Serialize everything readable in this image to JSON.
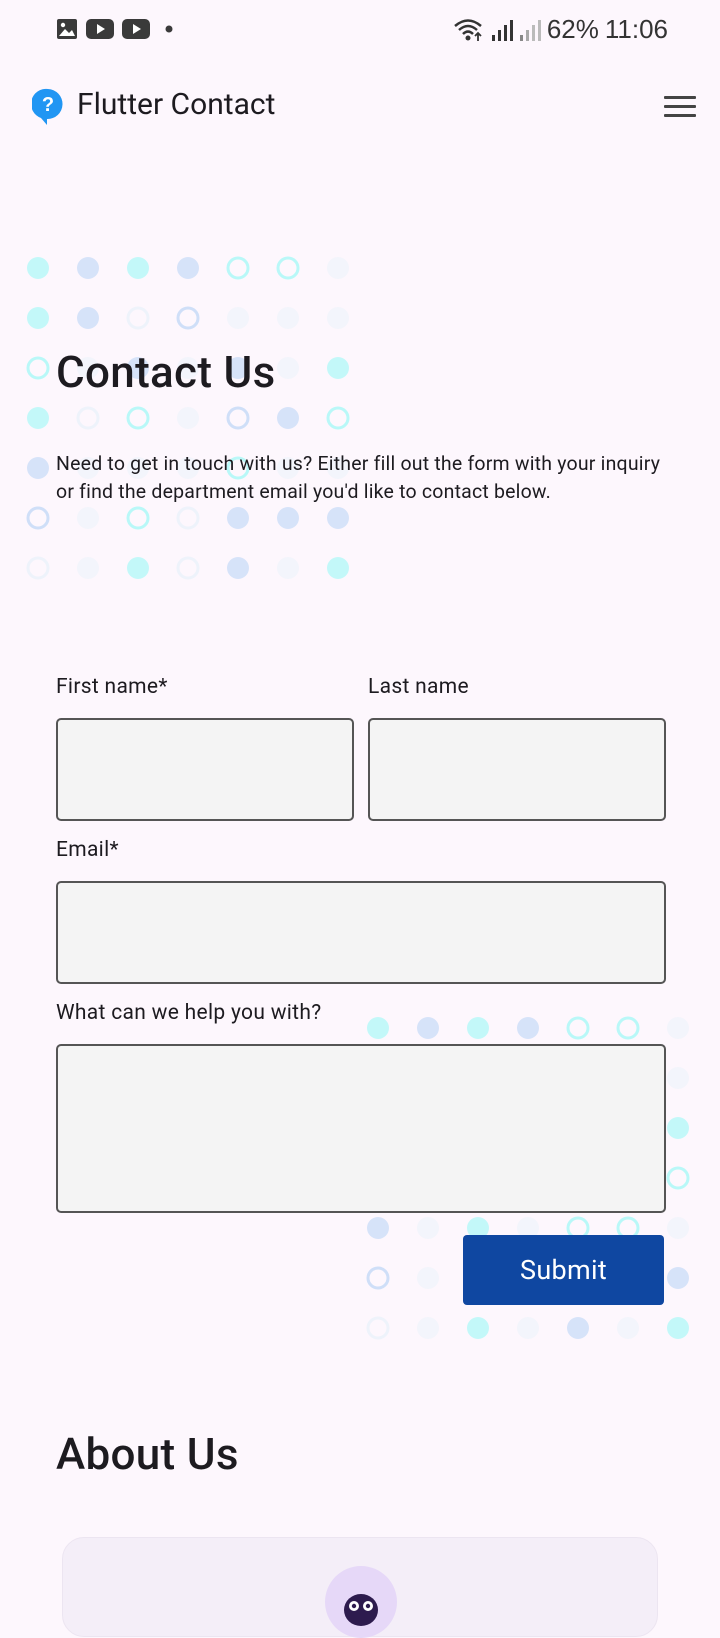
{
  "status_bar": {
    "left_icons": [
      "gallery-icon",
      "youtube-icon",
      "youtube-icon",
      "notification-dot-icon"
    ],
    "right_icons": [
      "wifi-icon",
      "signal-icon",
      "signal-icon"
    ],
    "battery": "62%",
    "time": "11:06"
  },
  "app_bar": {
    "title": "Flutter Contact",
    "logo_icon": "help-bubble-icon",
    "menu_icon": "hamburger-menu-icon"
  },
  "contact": {
    "heading": "Contact Us",
    "description": "Need to get in touch with us? Either fill out the form with your inquiry or find the department email you'd like to contact below."
  },
  "form": {
    "first_name_label": "First name*",
    "first_name_value": "",
    "last_name_label": "Last name",
    "last_name_value": "",
    "email_label": "Email*",
    "email_value": "",
    "message_label": "What can we help you with?",
    "message_value": "",
    "submit_label": "Submit"
  },
  "about": {
    "heading": "About Us"
  },
  "colors": {
    "background": "#fdf7fd",
    "primary_button": "#0f47a1",
    "field_background": "#f4f4f4",
    "logo_blue": "#2196f3",
    "dot_cyan": "#b9f8f8",
    "dot_blue": "#cfdff8"
  }
}
